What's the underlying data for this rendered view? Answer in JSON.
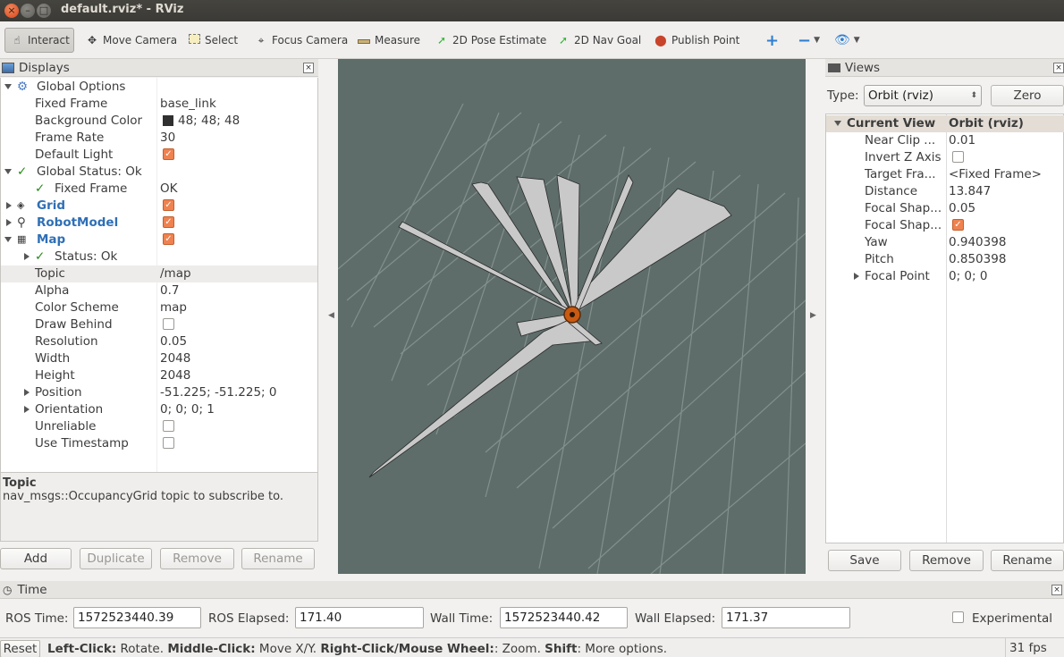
{
  "window": {
    "title": "default.rviz* - RViz"
  },
  "toolbar": {
    "tools": [
      {
        "label": "Interact",
        "icon": "hand-icon"
      },
      {
        "label": "Move Camera",
        "icon": "move-camera-icon"
      },
      {
        "label": "Select",
        "icon": "select-icon"
      },
      {
        "label": "Focus Camera",
        "icon": "focus-camera-icon"
      },
      {
        "label": "Measure",
        "icon": "ruler-icon"
      },
      {
        "label": "2D Pose Estimate",
        "icon": "pose-arrow-icon"
      },
      {
        "label": "2D Nav Goal",
        "icon": "nav-goal-arrow-icon"
      },
      {
        "label": "Publish Point",
        "icon": "map-pin-icon"
      }
    ]
  },
  "displays": {
    "title": "Displays",
    "rows": [
      {
        "label": "Global Options",
        "value": ""
      },
      {
        "label": "Fixed Frame",
        "value": "base_link"
      },
      {
        "label": "Background Color",
        "value": "48; 48; 48"
      },
      {
        "label": "Frame Rate",
        "value": "30"
      },
      {
        "label": "Default Light",
        "value": ""
      },
      {
        "label": "Global Status: Ok",
        "value": ""
      },
      {
        "label": "Fixed Frame",
        "value": "OK"
      },
      {
        "label": "Grid",
        "value": ""
      },
      {
        "label": "RobotModel",
        "value": ""
      },
      {
        "label": "Map",
        "value": ""
      },
      {
        "label": "Status: Ok",
        "value": ""
      },
      {
        "label": "Topic",
        "value": "/map"
      },
      {
        "label": "Alpha",
        "value": "0.7"
      },
      {
        "label": "Color Scheme",
        "value": "map"
      },
      {
        "label": "Draw Behind",
        "value": ""
      },
      {
        "label": "Resolution",
        "value": "0.05"
      },
      {
        "label": "Width",
        "value": "2048"
      },
      {
        "label": "Height",
        "value": "2048"
      },
      {
        "label": "Position",
        "value": "-51.225; -51.225; 0"
      },
      {
        "label": "Orientation",
        "value": "0; 0; 0; 1"
      },
      {
        "label": "Unreliable",
        "value": ""
      },
      {
        "label": "Use Timestamp",
        "value": ""
      }
    ],
    "description": {
      "title": "Topic",
      "text": "nav_msgs::OccupancyGrid topic to subscribe to."
    },
    "buttons": {
      "add": "Add",
      "duplicate": "Duplicate",
      "remove": "Remove",
      "rename": "Rename"
    }
  },
  "views": {
    "title": "Views",
    "type_label": "Type:",
    "type_value": "Orbit (rviz)",
    "zero": "Zero",
    "header": {
      "name": "Current View",
      "value": "Orbit (rviz)"
    },
    "rows": [
      {
        "label": "Near Clip ...",
        "value": "0.01"
      },
      {
        "label": "Invert Z Axis",
        "value": ""
      },
      {
        "label": "Target Fra...",
        "value": "<Fixed Frame>"
      },
      {
        "label": "Distance",
        "value": "13.847"
      },
      {
        "label": "Focal Shap...",
        "value": "0.05"
      },
      {
        "label": "Focal Shap...",
        "value": ""
      },
      {
        "label": "Yaw",
        "value": "0.940398"
      },
      {
        "label": "Pitch",
        "value": "0.850398"
      },
      {
        "label": "Focal Point",
        "value": "0; 0; 0"
      }
    ],
    "buttons": {
      "save": "Save",
      "remove": "Remove",
      "rename": "Rename"
    }
  },
  "time": {
    "title": "Time",
    "ros_time_label": "ROS Time:",
    "ros_time": "1572523440.39",
    "ros_elapsed_label": "ROS Elapsed:",
    "ros_elapsed": "171.40",
    "wall_time_label": "Wall Time:",
    "wall_time": "1572523440.42",
    "wall_elapsed_label": "Wall Elapsed:",
    "wall_elapsed": "171.37",
    "experimental": "Experimental"
  },
  "status": {
    "reset": "Reset",
    "k1": "Left-Click:",
    "t1": " Rotate. ",
    "k2": "Middle-Click:",
    "t2": " Move X/Y. ",
    "k3": "Right-Click/Mouse Wheel:",
    "t3": ": Zoom. ",
    "k4": "Shift",
    "t4": ": More options.",
    "fps": "31 fps"
  },
  "colors": {
    "checkbox_on": "#f0824f",
    "viewport_bg": "#5e6d6a",
    "tree_blue": "#2f6fb6",
    "ok_green": "#2a8a1d"
  }
}
